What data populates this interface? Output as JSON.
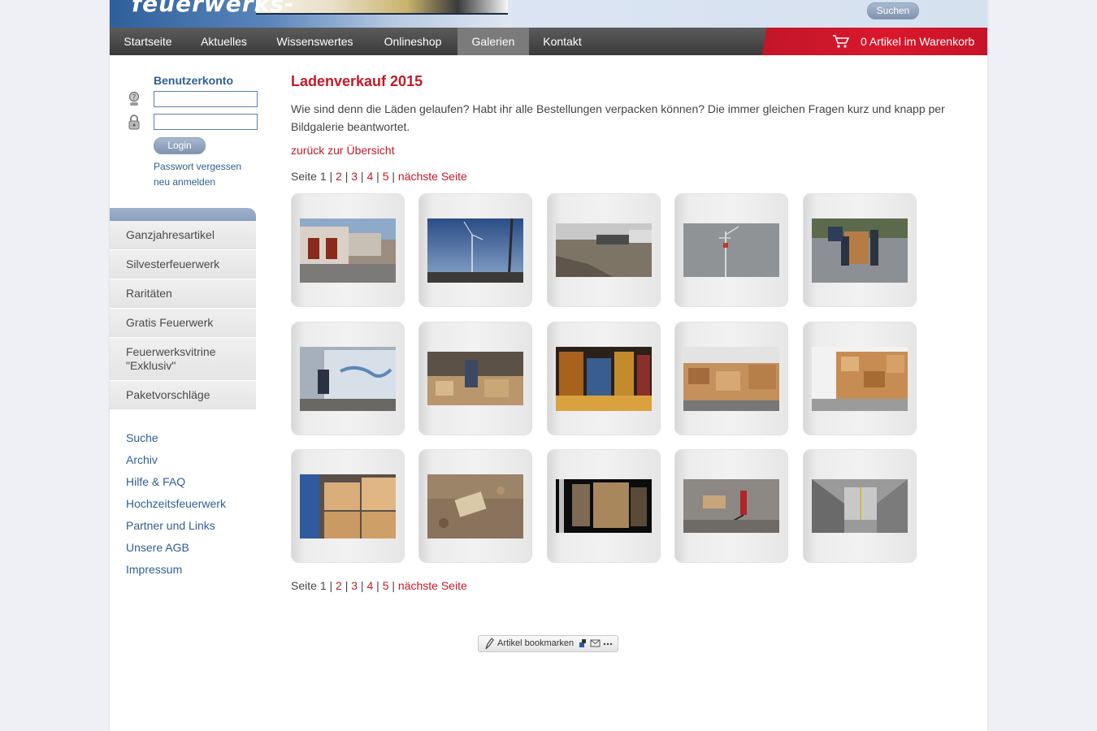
{
  "header": {
    "logo_text": "feuerwerks-",
    "search_label": "Suchen"
  },
  "nav": {
    "items": [
      {
        "label": "Startseite",
        "active": false
      },
      {
        "label": "Aktuelles",
        "active": false
      },
      {
        "label": "Wissenswertes",
        "active": false
      },
      {
        "label": "Onlineshop",
        "active": false
      },
      {
        "label": "Galerien",
        "active": true
      },
      {
        "label": "Kontakt",
        "active": false
      }
    ],
    "cart_text": "0 Artikel im Warenkorb"
  },
  "sidebar": {
    "login": {
      "title": "Benutzerkonto",
      "login_label": "Login",
      "forgot_label": "Passwort vergessen",
      "register_label": "neu anmelden"
    },
    "categories": [
      "Ganzjahresartikel",
      "Silvesterfeuerwerk",
      "Raritäten",
      "Gratis Feuerwerk",
      "Feuerwerksvitrine \"Exklusiv\"",
      "Paketvorschläge"
    ],
    "links": [
      "Suche",
      "Archiv",
      "Hilfe & FAQ",
      "Hochzeitsfeuerwerk",
      "Partner und Links",
      "Unsere AGB",
      "Impressum"
    ]
  },
  "content": {
    "title": "Ladenverkauf 2015",
    "intro": "Wie sind denn die Läden gelaufen? Habt ihr alle Bestellungen verpacken können? Die immer gleichen Fragen kurz und knapp per Bildgalerie beantwortet.",
    "back_label": "zurück zur Übersicht",
    "pager": {
      "prefix": "Seite",
      "current": "1",
      "pages": [
        "2",
        "3",
        "4",
        "5"
      ],
      "next_label": "nächste Seite"
    },
    "thumbnails": [
      {
        "scene": "building-street"
      },
      {
        "scene": "wind-turbine-sky"
      },
      {
        "scene": "construction-site"
      },
      {
        "scene": "crane-grey-sky"
      },
      {
        "scene": "people-hand-truck"
      },
      {
        "scene": "truck-loading"
      },
      {
        "scene": "warehouse-worker"
      },
      {
        "scene": "fireworks-shelves"
      },
      {
        "scene": "boxes-pallets"
      },
      {
        "scene": "boxes-stack-hall"
      },
      {
        "scene": "cardboard-closeup"
      },
      {
        "scene": "leaves-ground"
      },
      {
        "scene": "dark-truck-interior"
      },
      {
        "scene": "pallet-jack"
      },
      {
        "scene": "empty-hall"
      }
    ]
  },
  "footer": {
    "bookmark_label": "Artikel bookmarken"
  }
}
